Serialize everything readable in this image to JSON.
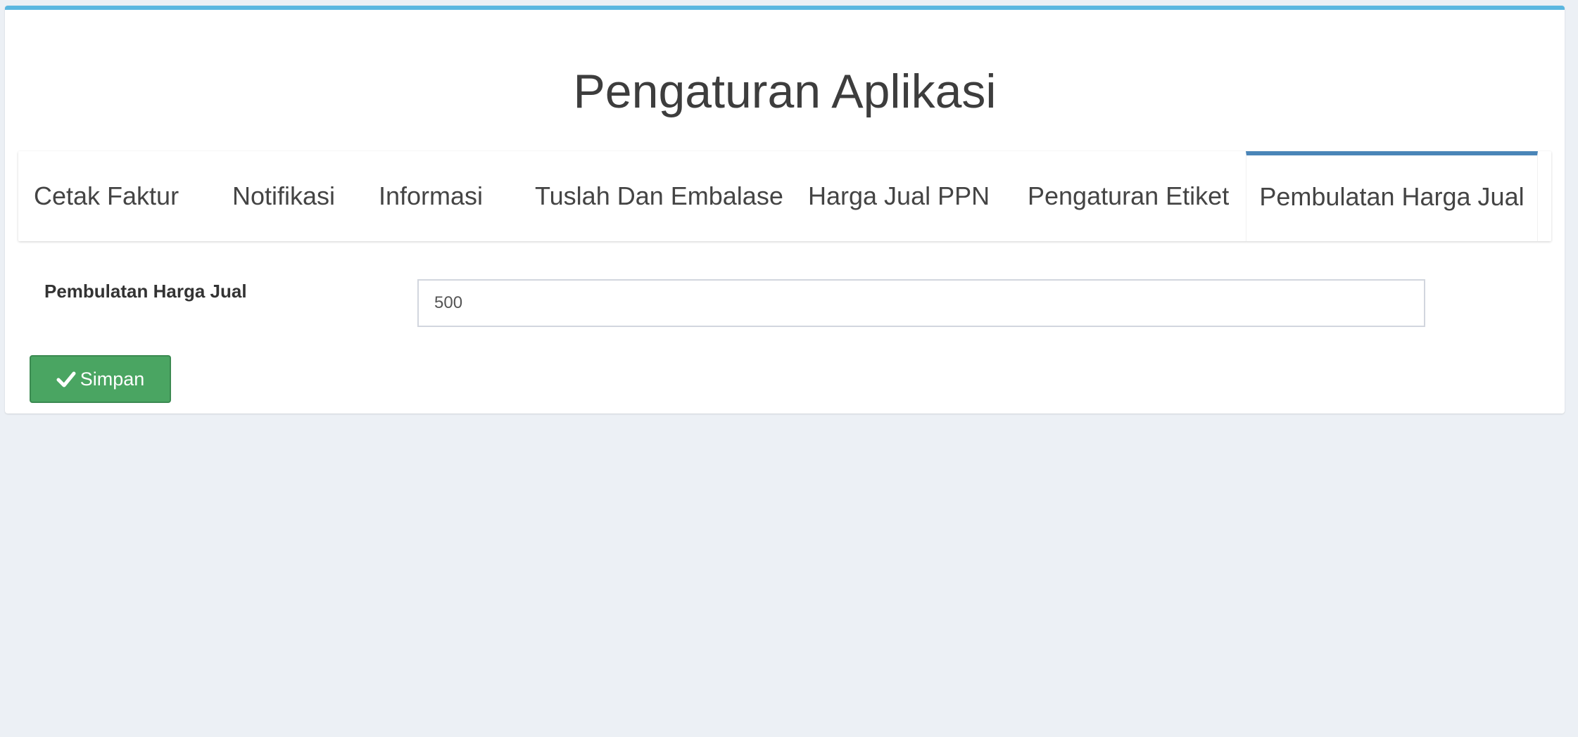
{
  "page": {
    "title": "Pengaturan Aplikasi"
  },
  "tabs": [
    {
      "label": "Cetak Faktur",
      "active": false
    },
    {
      "label": "Notifikasi",
      "active": false
    },
    {
      "label": "Informasi",
      "active": false
    },
    {
      "label": "Tuslah Dan Embalase",
      "active": false
    },
    {
      "label": "Harga Jual PPN",
      "active": false
    },
    {
      "label": "Pengaturan Etiket",
      "active": false
    },
    {
      "label": "Pembulatan Harga Jual",
      "active": true
    }
  ],
  "form": {
    "label": "Pembulatan Harga Jual",
    "value": "500"
  },
  "actions": {
    "save_label": "Simpan",
    "save_icon": "check-icon"
  },
  "colors": {
    "page_bg": "#ecf0f5",
    "box_top_border": "#5bb7e0",
    "active_tab_border": "#4a85b8",
    "save_button": "#4aa562"
  }
}
